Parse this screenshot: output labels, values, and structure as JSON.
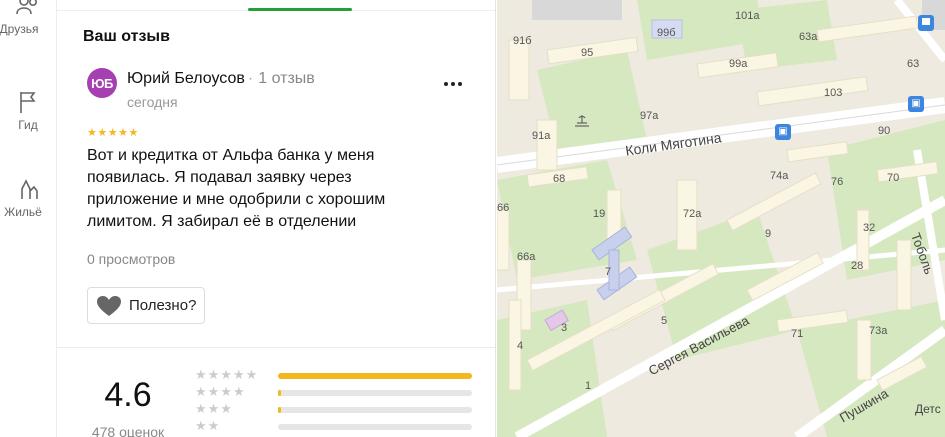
{
  "rail": {
    "items": [
      {
        "label": "Друзья",
        "icon": "friends-icon"
      },
      {
        "label": "Гид",
        "icon": "flag-icon"
      },
      {
        "label": "Жильё",
        "icon": "house-icon"
      }
    ]
  },
  "review": {
    "section_title": "Ваш отзыв",
    "avatar_initials": "ЮБ",
    "author_name": "Юрий Белоусов",
    "author_reviews": "1 отзыв",
    "date": "сегодня",
    "stars": "★★★★★",
    "text": "Вот и кредитка от Альфа банка у меня появилась. Я подавал заявку через приложение и мне одобрили с хорошим лимитом. Я забирал её в отделении",
    "views": "0 просмотров",
    "useful_label": "Полезно?"
  },
  "rating": {
    "value": "4.6",
    "count": "478 оценок",
    "distribution": [
      {
        "stars": "★★★★★",
        "fraction": 1.0
      },
      {
        "stars": "★★★★",
        "fraction": 0.01
      },
      {
        "stars": "★★★",
        "fraction": 0.01
      },
      {
        "stars": "★★",
        "fraction": 0.0
      }
    ]
  },
  "map": {
    "streets": [
      "Коли Мяготина",
      "Сергея Васильева",
      "Пушкина",
      "Тоболь"
    ],
    "labels": [
      "91б",
      "95",
      "99б",
      "101а",
      "63а",
      "63",
      "99а",
      "103",
      "97а",
      "91а",
      "90",
      "68",
      "74а",
      "76",
      "70",
      "66",
      "19",
      "72а",
      "9",
      "32",
      "66а",
      "7",
      "28",
      "3",
      "5",
      "4",
      "71",
      "73а",
      "1",
      "Детс"
    ]
  },
  "colors": {
    "accent_green": "#21a038",
    "star_yellow": "#f5b71e",
    "avatar_purple": "#a63fb1",
    "bus_blue": "#3d86e0"
  }
}
